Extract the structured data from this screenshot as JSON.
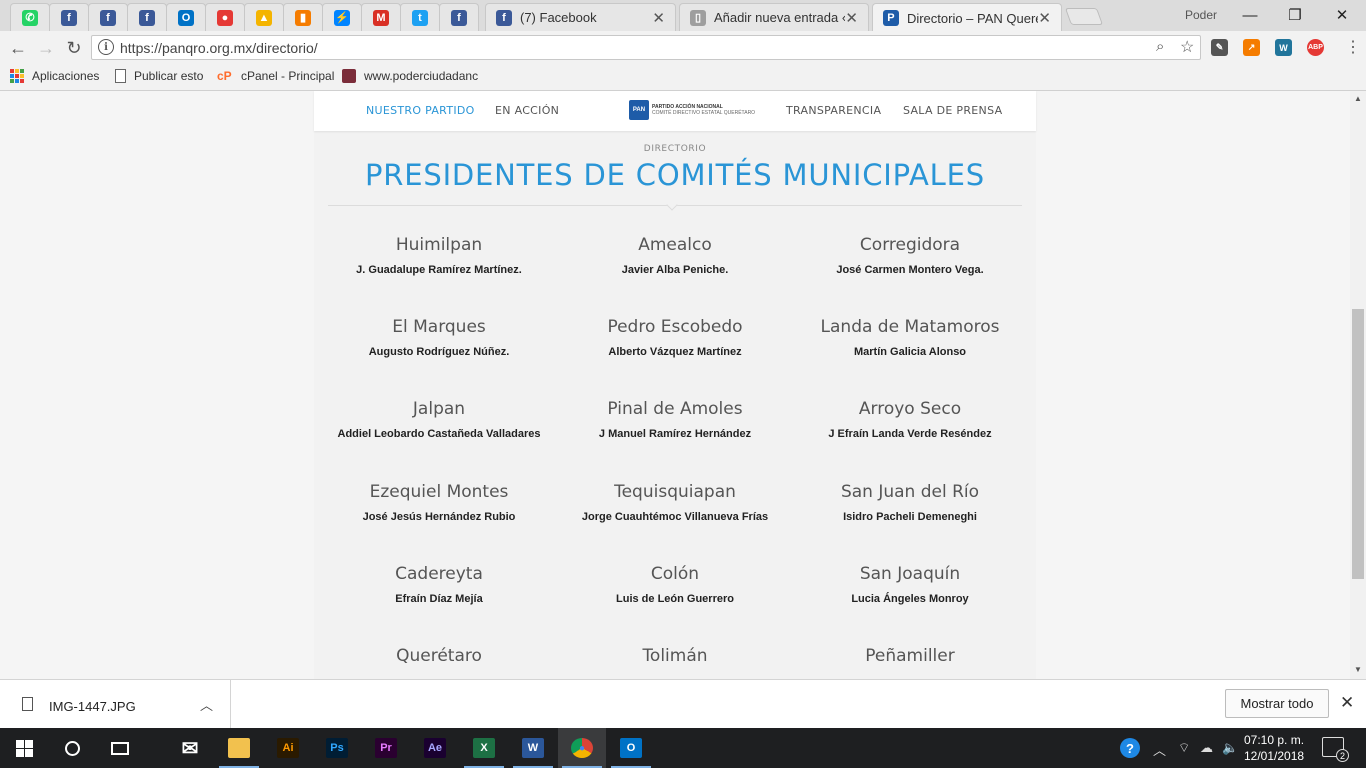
{
  "browser": {
    "pinned_tabs": [
      {
        "icon": "whatsapp-icon",
        "color": "#25d366",
        "glyph": "✆"
      },
      {
        "icon": "facebook-icon",
        "color": "#3b5998",
        "glyph": "f"
      },
      {
        "icon": "facebook-icon",
        "color": "#3b5998",
        "glyph": "f"
      },
      {
        "icon": "facebook-icon",
        "color": "#3b5998",
        "glyph": "f"
      },
      {
        "icon": "outlook-icon",
        "color": "#0072c6",
        "glyph": "O"
      },
      {
        "icon": "record-icon",
        "color": "#e53935",
        "glyph": "●"
      },
      {
        "icon": "google-ads-icon",
        "color": "#f4b400",
        "glyph": "▲"
      },
      {
        "icon": "analytics-icon",
        "color": "#f57c00",
        "glyph": "▮"
      },
      {
        "icon": "messenger-icon",
        "color": "#0084ff",
        "glyph": "⚡"
      },
      {
        "icon": "gmail-icon",
        "color": "#d93025",
        "glyph": "M"
      },
      {
        "icon": "twitter-icon",
        "color": "#1da1f2",
        "glyph": "t"
      },
      {
        "icon": "facebook-icon",
        "color": "#3b5998",
        "glyph": "f"
      }
    ],
    "tabs": [
      {
        "title": "(7) Facebook",
        "icon": "facebook-icon",
        "color": "#3b5998",
        "glyph": "f"
      },
      {
        "title": "Añadir nueva entrada ‹ P",
        "icon": "document-icon",
        "color": "#9e9e9e",
        "glyph": "▯"
      },
      {
        "title": "Directorio – PAN Queréta",
        "icon": "pan-icon",
        "color": "#1e5ca8",
        "glyph": "P"
      }
    ],
    "profile_name": "Poder",
    "url": "https://panqro.org.mx/directorio/",
    "bookmarks": [
      {
        "label": "Aplicaciones",
        "icon": "apps-icon"
      },
      {
        "label": "Publicar esto",
        "icon": "page-icon"
      },
      {
        "label": "cPanel - Principal",
        "icon": "cpanel-icon"
      },
      {
        "label": "www.poderciudadanc",
        "icon": "site-icon"
      }
    ],
    "extensions": [
      {
        "icon": "evernote-icon",
        "color": "#555555",
        "glyph": "✎"
      },
      {
        "icon": "chart-icon",
        "color": "#f57c00",
        "glyph": "↗"
      },
      {
        "icon": "wordpress-icon",
        "color": "#21759b",
        "glyph": "W"
      },
      {
        "icon": "adblock-icon",
        "color": "#e53935",
        "glyph": "ABP"
      }
    ]
  },
  "site": {
    "nav": {
      "left": [
        "NUESTRO PARTIDO",
        "EN ACCIÓN"
      ],
      "right": [
        "TRANSPARENCIA",
        "SALA DE PRENSA"
      ],
      "logo_mark": "PAN",
      "logo_line1": "PARTIDO ACCIÓN NACIONAL",
      "logo_line2": "COMITÉ DIRECTIVO ESTATAL QUERÉTARO"
    },
    "kicker": "DIRECTORIO",
    "title": "PRESIDENTES DE COMITÉS MUNICIPALES",
    "rows": [
      [
        {
          "town": "Huimilpan",
          "person": "J. Guadalupe Ramírez Martínez."
        },
        {
          "town": "Amealco",
          "person": "Javier Alba Peniche."
        },
        {
          "town": "Corregidora",
          "person": "José Carmen Montero Vega."
        }
      ],
      [
        {
          "town": "El Marques",
          "person": "Augusto Rodríguez Núñez."
        },
        {
          "town": "Pedro Escobedo",
          "person": "Alberto Vázquez Martínez"
        },
        {
          "town": "Landa de Matamoros",
          "person": "Martín Galicia Alonso"
        }
      ],
      [
        {
          "town": "Jalpan",
          "person": "Addiel Leobardo Castañeda Valladares"
        },
        {
          "town": "Pinal de Amoles",
          "person": "J Manuel Ramírez Hernández"
        },
        {
          "town": "Arroyo Seco",
          "person": "J Efraín Landa Verde Reséndez"
        }
      ],
      [
        {
          "town": "Ezequiel Montes",
          "person": "José Jesús Hernández Rubio"
        },
        {
          "town": "Tequisquiapan",
          "person": "Jorge Cuauhtémoc Villanueva Frías"
        },
        {
          "town": "San Juan del Río",
          "person": "Isidro Pacheli Demeneghi"
        }
      ],
      [
        {
          "town": "Cadereyta",
          "person": "Efraín Díaz Mejía"
        },
        {
          "town": "Colón",
          "person": "Luis de León Guerrero"
        },
        {
          "town": "San Joaquín",
          "person": "Lucia Ángeles Monroy"
        }
      ],
      [
        {
          "town": "Querétaro",
          "person": ""
        },
        {
          "town": "Tolimán",
          "person": ""
        },
        {
          "town": "Peñamiller",
          "person": ""
        }
      ]
    ]
  },
  "downloads": {
    "file_name": "IMG-1447.JPG",
    "show_all_label": "Mostrar todo"
  },
  "taskbar": {
    "apps": [
      {
        "icon": "mail-icon",
        "label": "✉",
        "bg": "transparent",
        "fg": "#ffffff"
      },
      {
        "icon": "file-explorer-icon",
        "label": "▬",
        "bg": "#f2c14e",
        "fg": "#f2c14e"
      },
      {
        "icon": "illustrator-icon",
        "label": "Ai",
        "bg": "#2a1a00",
        "fg": "#ff9a00"
      },
      {
        "icon": "photoshop-icon",
        "label": "Ps",
        "bg": "#001d34",
        "fg": "#31a8ff"
      },
      {
        "icon": "premiere-icon",
        "label": "Pr",
        "bg": "#2a0030",
        "fg": "#e77bff"
      },
      {
        "icon": "after-effects-icon",
        "label": "Ae",
        "bg": "#1a0030",
        "fg": "#a8a8ff"
      },
      {
        "icon": "excel-icon",
        "label": "X",
        "bg": "#1d7044",
        "fg": "#ffffff"
      },
      {
        "icon": "word-icon",
        "label": "W",
        "bg": "#2b579a",
        "fg": "#ffffff"
      },
      {
        "icon": "chrome-icon",
        "label": "●",
        "bg": "transparent",
        "fg": "#e0b000"
      },
      {
        "icon": "outlook-icon",
        "label": "O",
        "bg": "#0072c6",
        "fg": "#ffffff"
      }
    ],
    "time": "07:10 p. m.",
    "date": "12/01/2018",
    "notifications": "2"
  }
}
